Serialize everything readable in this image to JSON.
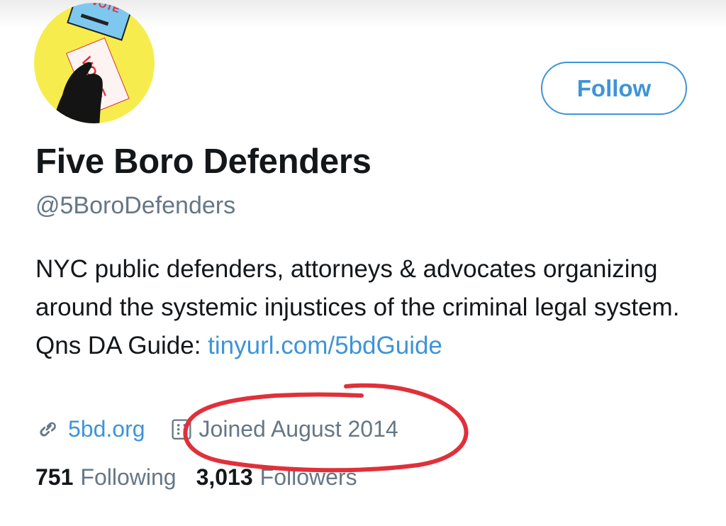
{
  "profile": {
    "avatar_text_top": "VOTE",
    "avatar_text_card": "VOICE",
    "follow_label": "Follow",
    "display_name": "Five Boro Defenders",
    "handle": "@5BoroDefenders",
    "bio_text": "NYC public defenders, attorneys & advocates organizing around the systemic injustices of the criminal legal system. Qns DA Guide: ",
    "bio_link": "tinyurl.com/5bdGuide",
    "website": "5bd.org",
    "joined": "Joined August 2014",
    "website_icon": "link-icon",
    "joined_icon": "calendar-icon"
  },
  "stats": {
    "following_count": "751",
    "following_label": "Following",
    "followers_count": "3,013",
    "followers_label": "Followers"
  },
  "colors": {
    "accent": "#3d94d8",
    "secondary_text": "#657786",
    "primary_text": "#14171a",
    "annotation": "#e0303a",
    "avatar_bg": "#f6ec4e"
  }
}
